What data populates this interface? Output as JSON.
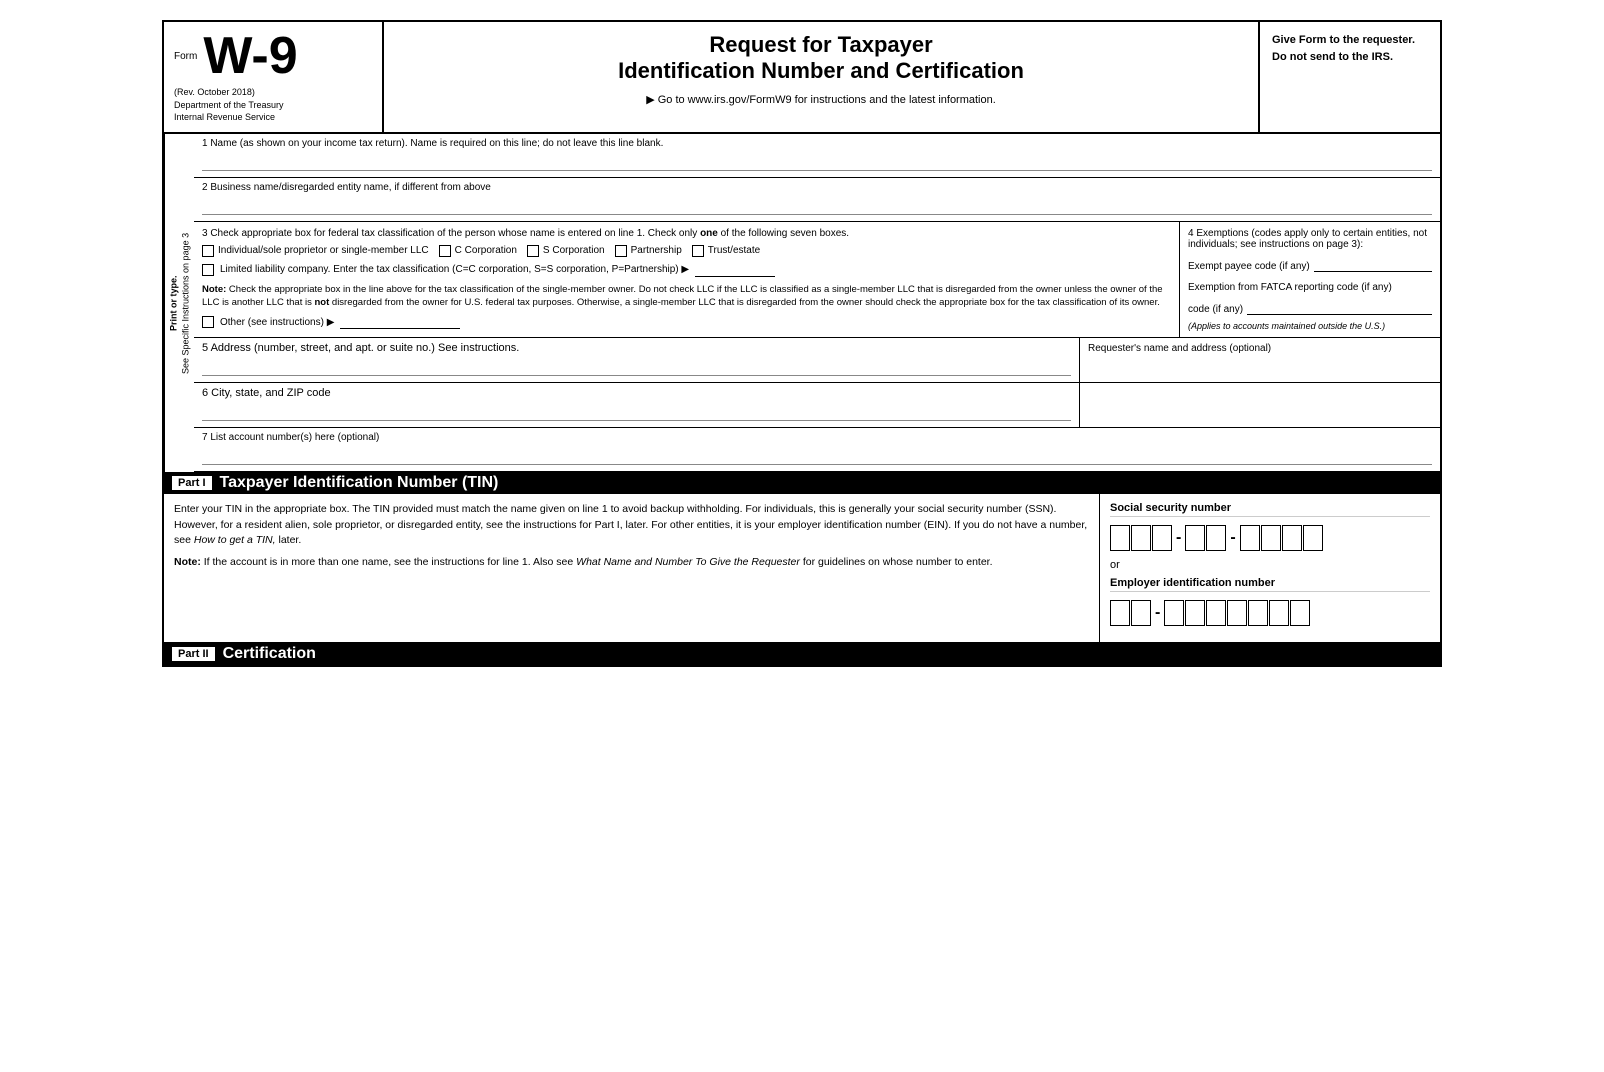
{
  "header": {
    "form_label": "Form",
    "form_number": "W-9",
    "rev_date": "(Rev. October 2018)",
    "dept": "Department of the Treasury",
    "irs": "Internal Revenue Service",
    "title_line1": "Request for Taxpayer",
    "title_line2": "Identification Number and Certification",
    "goto": "▶ Go to www.irs.gov/FormW9 for instructions and the latest information.",
    "give_form": "Give Form to the requester. Do not send to the IRS."
  },
  "side_label": {
    "line1": "Print or type.",
    "line2": "See Specific Instructions on page 3"
  },
  "fields": {
    "line1_label": "1  Name (as shown on your income tax return). Name is required on this line; do not leave this line blank.",
    "line2_label": "2  Business name/disregarded entity name, if different from above",
    "line3_label": "3  Check appropriate box for federal tax classification of the person whose name is entered on line 1. Check only",
    "line3_label_one": "one",
    "line3_label_end": "of the following seven boxes.",
    "exemptions_title": "4  Exemptions (codes apply only to certain entities, not individuals; see instructions on page 3):",
    "exempt_payee_label": "Exempt payee code (if any)",
    "fatca_label": "Exemption from FATCA reporting code (if any)",
    "fatca_note": "(Applies to accounts maintained outside the U.S.)",
    "checkbox_individual": "Individual/sole proprietor or single-member LLC",
    "checkbox_c_corp": "C Corporation",
    "checkbox_s_corp": "S Corporation",
    "checkbox_partnership": "Partnership",
    "checkbox_trust": "Trust/estate",
    "llc_label": "Limited liability company. Enter the tax classification (C=C corporation, S=S corporation, P=Partnership) ▶",
    "note_label": "Note:",
    "note_text": "Check the appropriate box in the line above for the tax classification of the single-member owner. Do not check LLC if the LLC is classified as a single-member LLC that is disregarded from the owner unless the owner of the LLC is another LLC that is",
    "note_not": "not",
    "note_text2": "disregarded from the owner for U.S. federal tax purposes. Otherwise, a single-member LLC that is disregarded from the owner should check the appropriate box for the tax classification of its owner.",
    "other_label": "Other (see instructions) ▶",
    "line5_label": "5  Address (number, street, and apt. or suite no.) See instructions.",
    "line5_right": "Requester's name and address (optional)",
    "line6_label": "6  City, state, and ZIP code",
    "line7_label": "7  List account number(s) here (optional)"
  },
  "part1": {
    "label": "Part I",
    "title": "Taxpayer Identification Number (TIN)",
    "body_text": "Enter your TIN in the appropriate box. The TIN provided must match the name given on line 1 to avoid backup withholding. For individuals, this is generally your social security number (SSN). However, for a resident alien, sole proprietor, or disregarded entity, see the instructions for Part I, later. For other entities, it is your employer identification number (EIN). If you do not have a number, see",
    "how_to_get": "How to get a TIN,",
    "body_text2": "later.",
    "note_label": "Note:",
    "note_text": "If the account is in more than one name, see the instructions for line 1. Also see",
    "what_name": "What Name and Number To Give the Requester",
    "note_text2": "for guidelines on whose number to enter.",
    "ssn_label": "Social security number",
    "ssn_digits": [
      "",
      "",
      "",
      "",
      "",
      "",
      "",
      "",
      ""
    ],
    "or_text": "or",
    "ein_label": "Employer identification number",
    "ein_digits": [
      "",
      "",
      "",
      "",
      "",
      "",
      "",
      "",
      ""
    ]
  },
  "part2": {
    "label": "Part II",
    "title": "Certification"
  }
}
